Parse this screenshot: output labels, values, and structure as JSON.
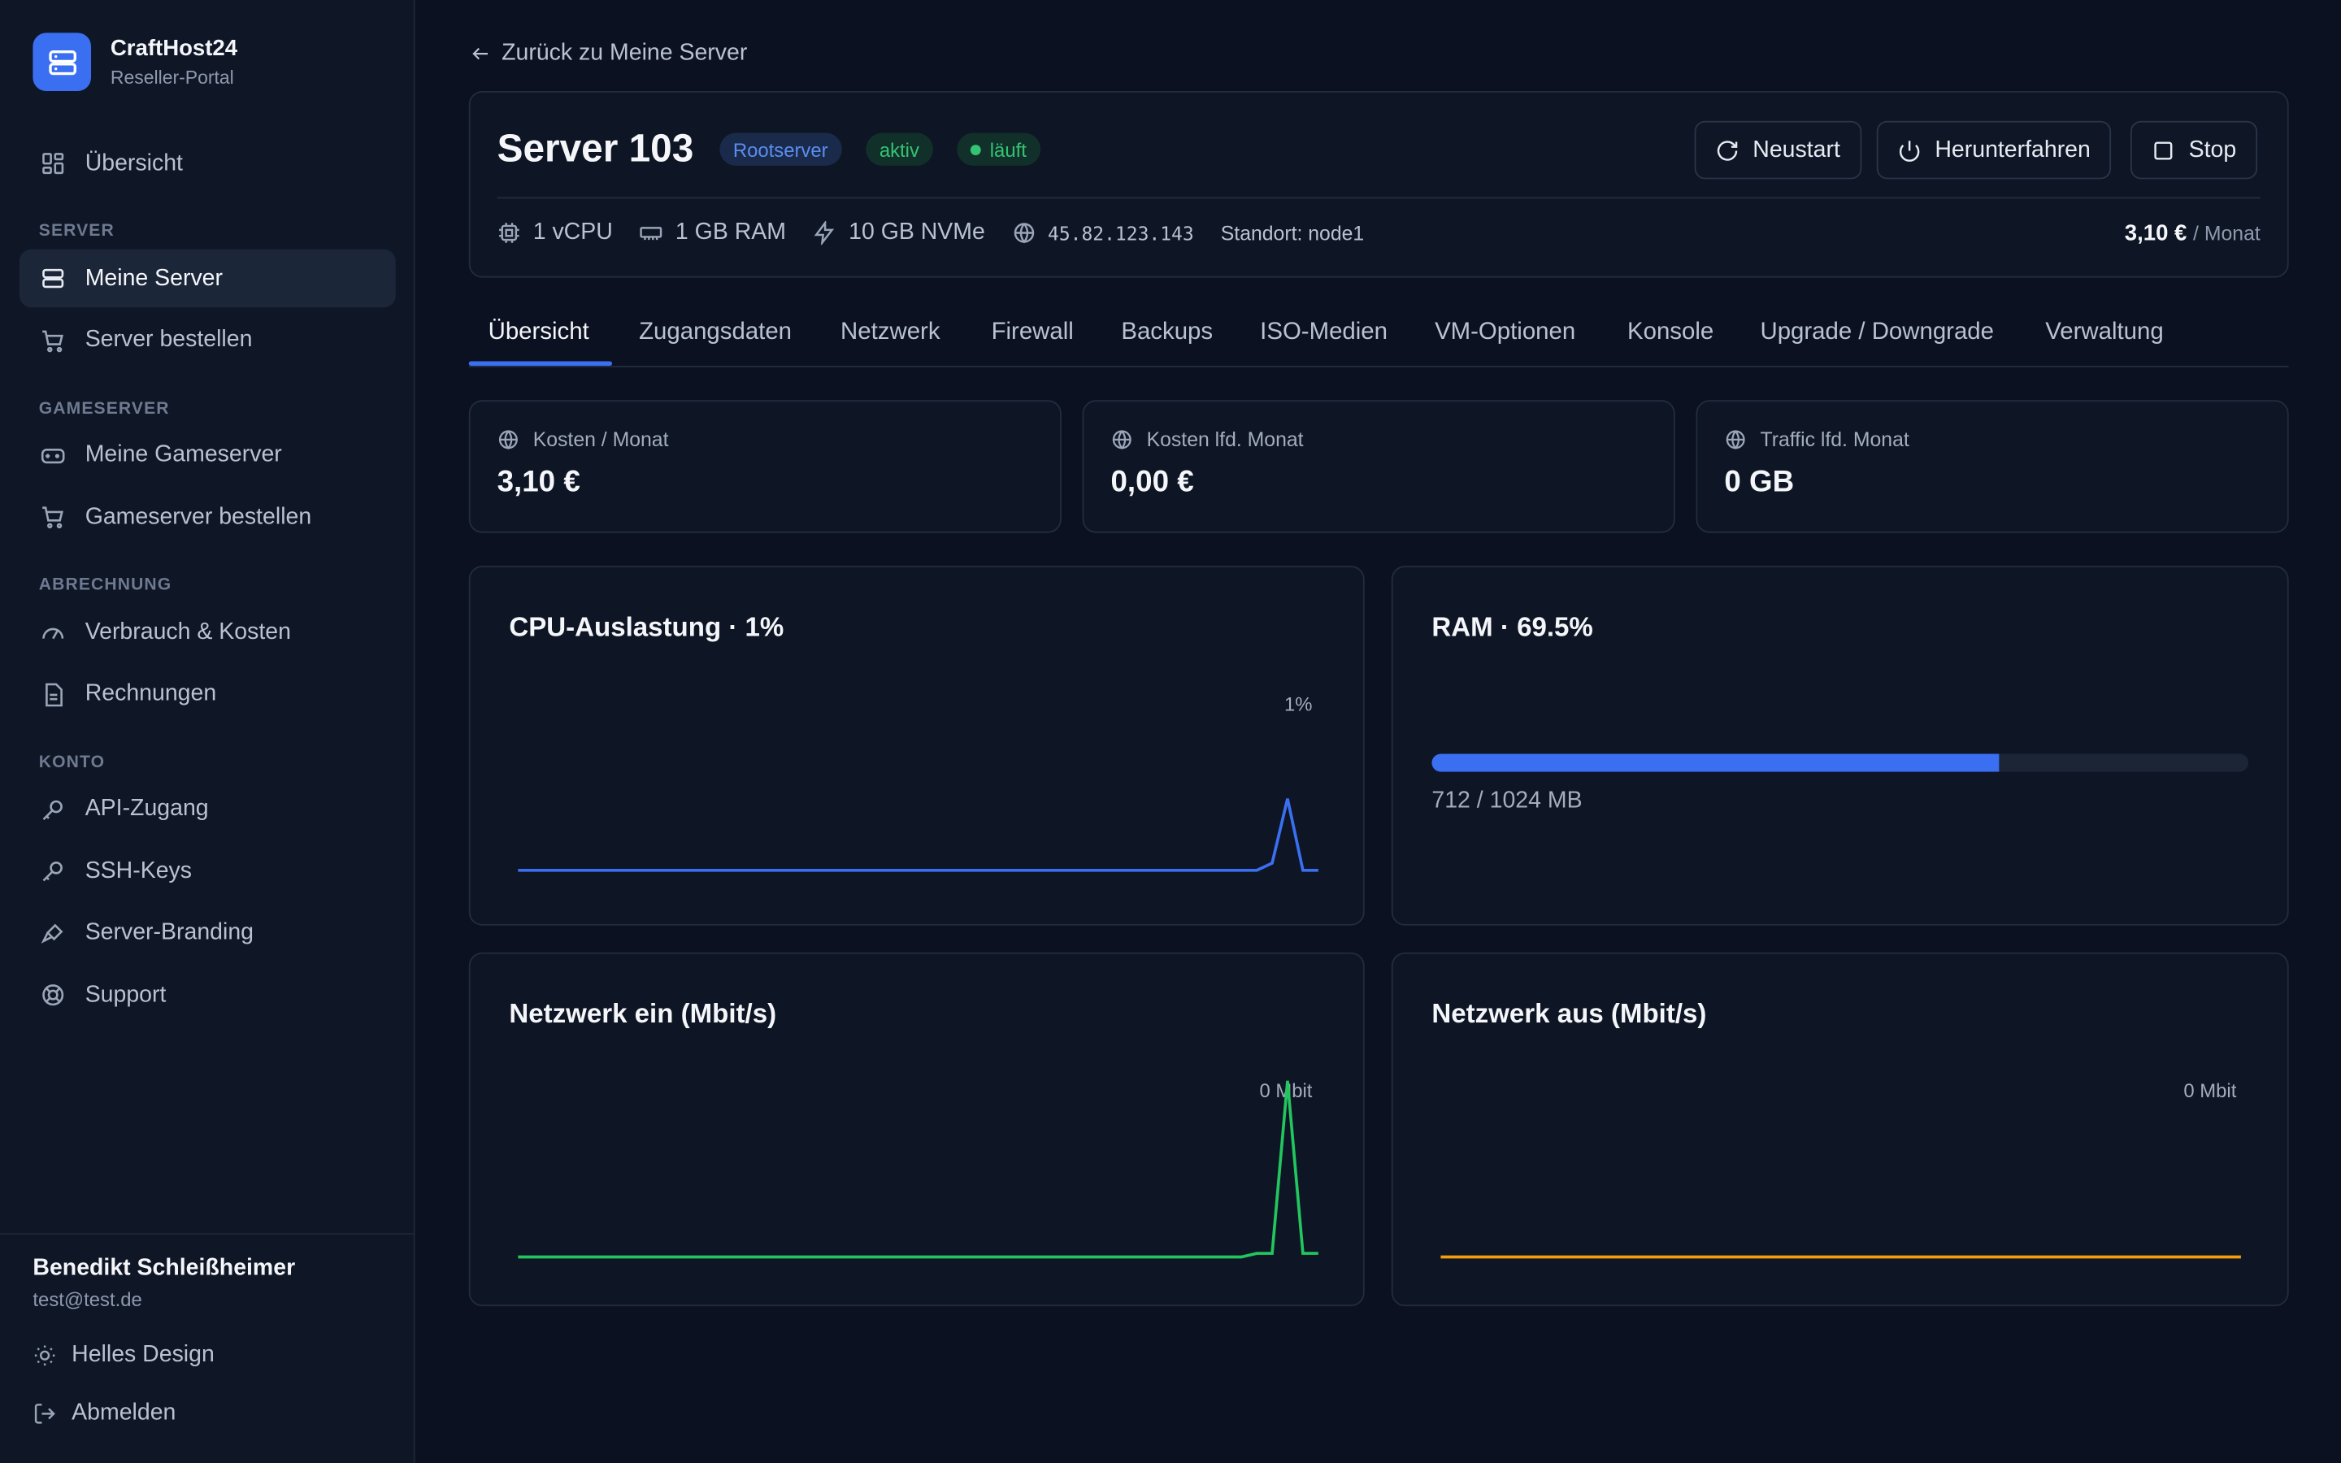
{
  "brand": {
    "name": "CraftHost24",
    "subtitle": "Reseller-Portal"
  },
  "sidebar": {
    "overview": "Übersicht",
    "sections": {
      "server": "SERVER",
      "gameserver": "GAMESERVER",
      "billing": "ABRECHNUNG",
      "account": "KONTO"
    },
    "items": {
      "my_servers": "Meine Server",
      "order_server": "Server bestellen",
      "my_gameservers": "Meine Gameserver",
      "order_gameserver": "Gameserver bestellen",
      "usage": "Verbrauch & Kosten",
      "invoices": "Rechnungen",
      "api": "API-Zugang",
      "ssh": "SSH-Keys",
      "branding": "Server-Branding",
      "support": "Support"
    },
    "user": {
      "name": "Benedikt Schleißheimer",
      "email": "test@test.de"
    },
    "theme_toggle": "Helles Design",
    "logout": "Abmelden"
  },
  "back_link": "Zurück zu Meine Server",
  "server": {
    "title": "Server 103",
    "badge_type": "Rootserver",
    "badge_status": "aktiv",
    "badge_running": "läuft",
    "buttons": {
      "restart": "Neustart",
      "shutdown": "Herunterfahren",
      "stop": "Stop"
    },
    "specs": {
      "cpu": "1 vCPU",
      "ram": "1 GB RAM",
      "disk": "10 GB NVMe",
      "ip": "45.82.123.143",
      "location": "Standort: node1"
    },
    "price": "3,10 €",
    "price_per": "/ Monat"
  },
  "tabs": [
    "Übersicht",
    "Zugangsdaten",
    "Netzwerk",
    "Firewall",
    "Backups",
    "ISO-Medien",
    "VM-Optionen",
    "Konsole",
    "Upgrade / Downgrade",
    "Verwaltung"
  ],
  "stats": [
    {
      "label": "Kosten / Monat",
      "value": "3,10 €"
    },
    {
      "label": "Kosten lfd. Monat",
      "value": "0,00 €"
    },
    {
      "label": "Traffic lfd. Monat",
      "value": "0 GB"
    }
  ],
  "colors": {
    "accent": "#3b6ff2",
    "green": "#22c55e",
    "orange": "#f59e0b"
  },
  "cpu_chart": {
    "title": "CPU-Auslastung · 1%",
    "current_label": "1%"
  },
  "ram": {
    "title": "RAM · 69.5%",
    "percent": 69.5,
    "used_text": "712 / 1024 MB"
  },
  "net_in": {
    "title": "Netzwerk ein (Mbit/s)",
    "current_label": "0 Mbit"
  },
  "net_out": {
    "title": "Netzwerk aus (Mbit/s)",
    "current_label": "0 Mbit"
  },
  "chart_data": [
    {
      "type": "line",
      "title": "CPU-Auslastung · 1%",
      "series": [
        {
          "values": [
            0,
            0,
            0,
            0,
            0,
            0,
            0,
            0,
            0,
            0,
            0,
            0,
            0,
            0,
            0,
            0,
            0,
            0,
            0,
            0,
            0,
            0,
            0,
            0,
            0,
            0,
            0,
            0,
            0,
            0,
            0,
            0,
            0,
            0,
            0,
            0,
            0,
            0,
            0,
            0,
            0,
            0,
            0,
            0,
            0,
            0,
            0,
            0,
            0,
            0.1,
            1,
            0,
            0
          ]
        }
      ]
    },
    {
      "type": "line",
      "title": "Netzwerk ein (Mbit/s)",
      "series": [
        {
          "values": [
            0,
            0,
            0,
            0,
            0,
            0,
            0,
            0,
            0,
            0,
            0,
            0,
            0,
            0,
            0,
            0,
            0,
            0,
            0,
            0,
            0,
            0,
            0,
            0,
            0,
            0,
            0,
            0,
            0,
            0,
            0,
            0,
            0,
            0,
            0,
            0,
            0,
            0,
            0,
            0,
            0,
            0,
            0,
            0,
            0,
            0,
            0,
            0,
            0.02,
            0.02,
            1,
            0.02,
            0.02
          ]
        }
      ]
    },
    {
      "type": "line",
      "title": "Netzwerk aus (Mbit/s)",
      "series": [
        {
          "values": [
            0,
            0,
            0,
            0,
            0,
            0,
            0,
            0,
            0,
            0,
            0,
            0,
            0,
            0,
            0,
            0,
            0,
            0,
            0,
            0,
            0,
            0,
            0,
            0,
            0,
            0,
            0,
            0,
            0,
            0,
            0,
            0,
            0,
            0,
            0,
            0,
            0,
            0,
            0,
            0,
            0,
            0,
            0,
            0,
            0,
            0,
            0,
            0,
            0,
            0,
            0,
            0,
            0
          ]
        }
      ]
    }
  ]
}
